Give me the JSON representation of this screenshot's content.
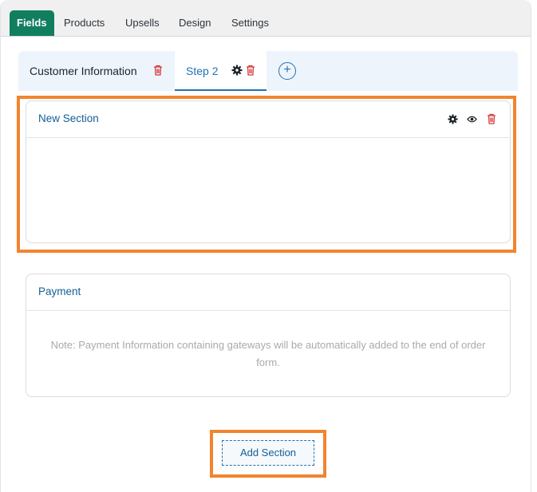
{
  "top_tabs": [
    "Fields",
    "Products",
    "Upsells",
    "Design",
    "Settings"
  ],
  "steps": {
    "step1_label": "Customer Information",
    "step2_label": "Step 2"
  },
  "sections": {
    "new_section_title": "New Section",
    "payment_title": "Payment",
    "payment_note": "Note: Payment Information containing gateways will be automatically added to the end of order form."
  },
  "add_section_label": "Add Section",
  "add_step_label": "+",
  "colors": {
    "active_tab": "#127e60",
    "accent_blue": "#2271b1",
    "delete_red": "#d63638",
    "highlight_orange": "#f2842e"
  },
  "icons": [
    "trash-icon",
    "gear-icon",
    "eye-icon",
    "plus-circle-icon"
  ]
}
